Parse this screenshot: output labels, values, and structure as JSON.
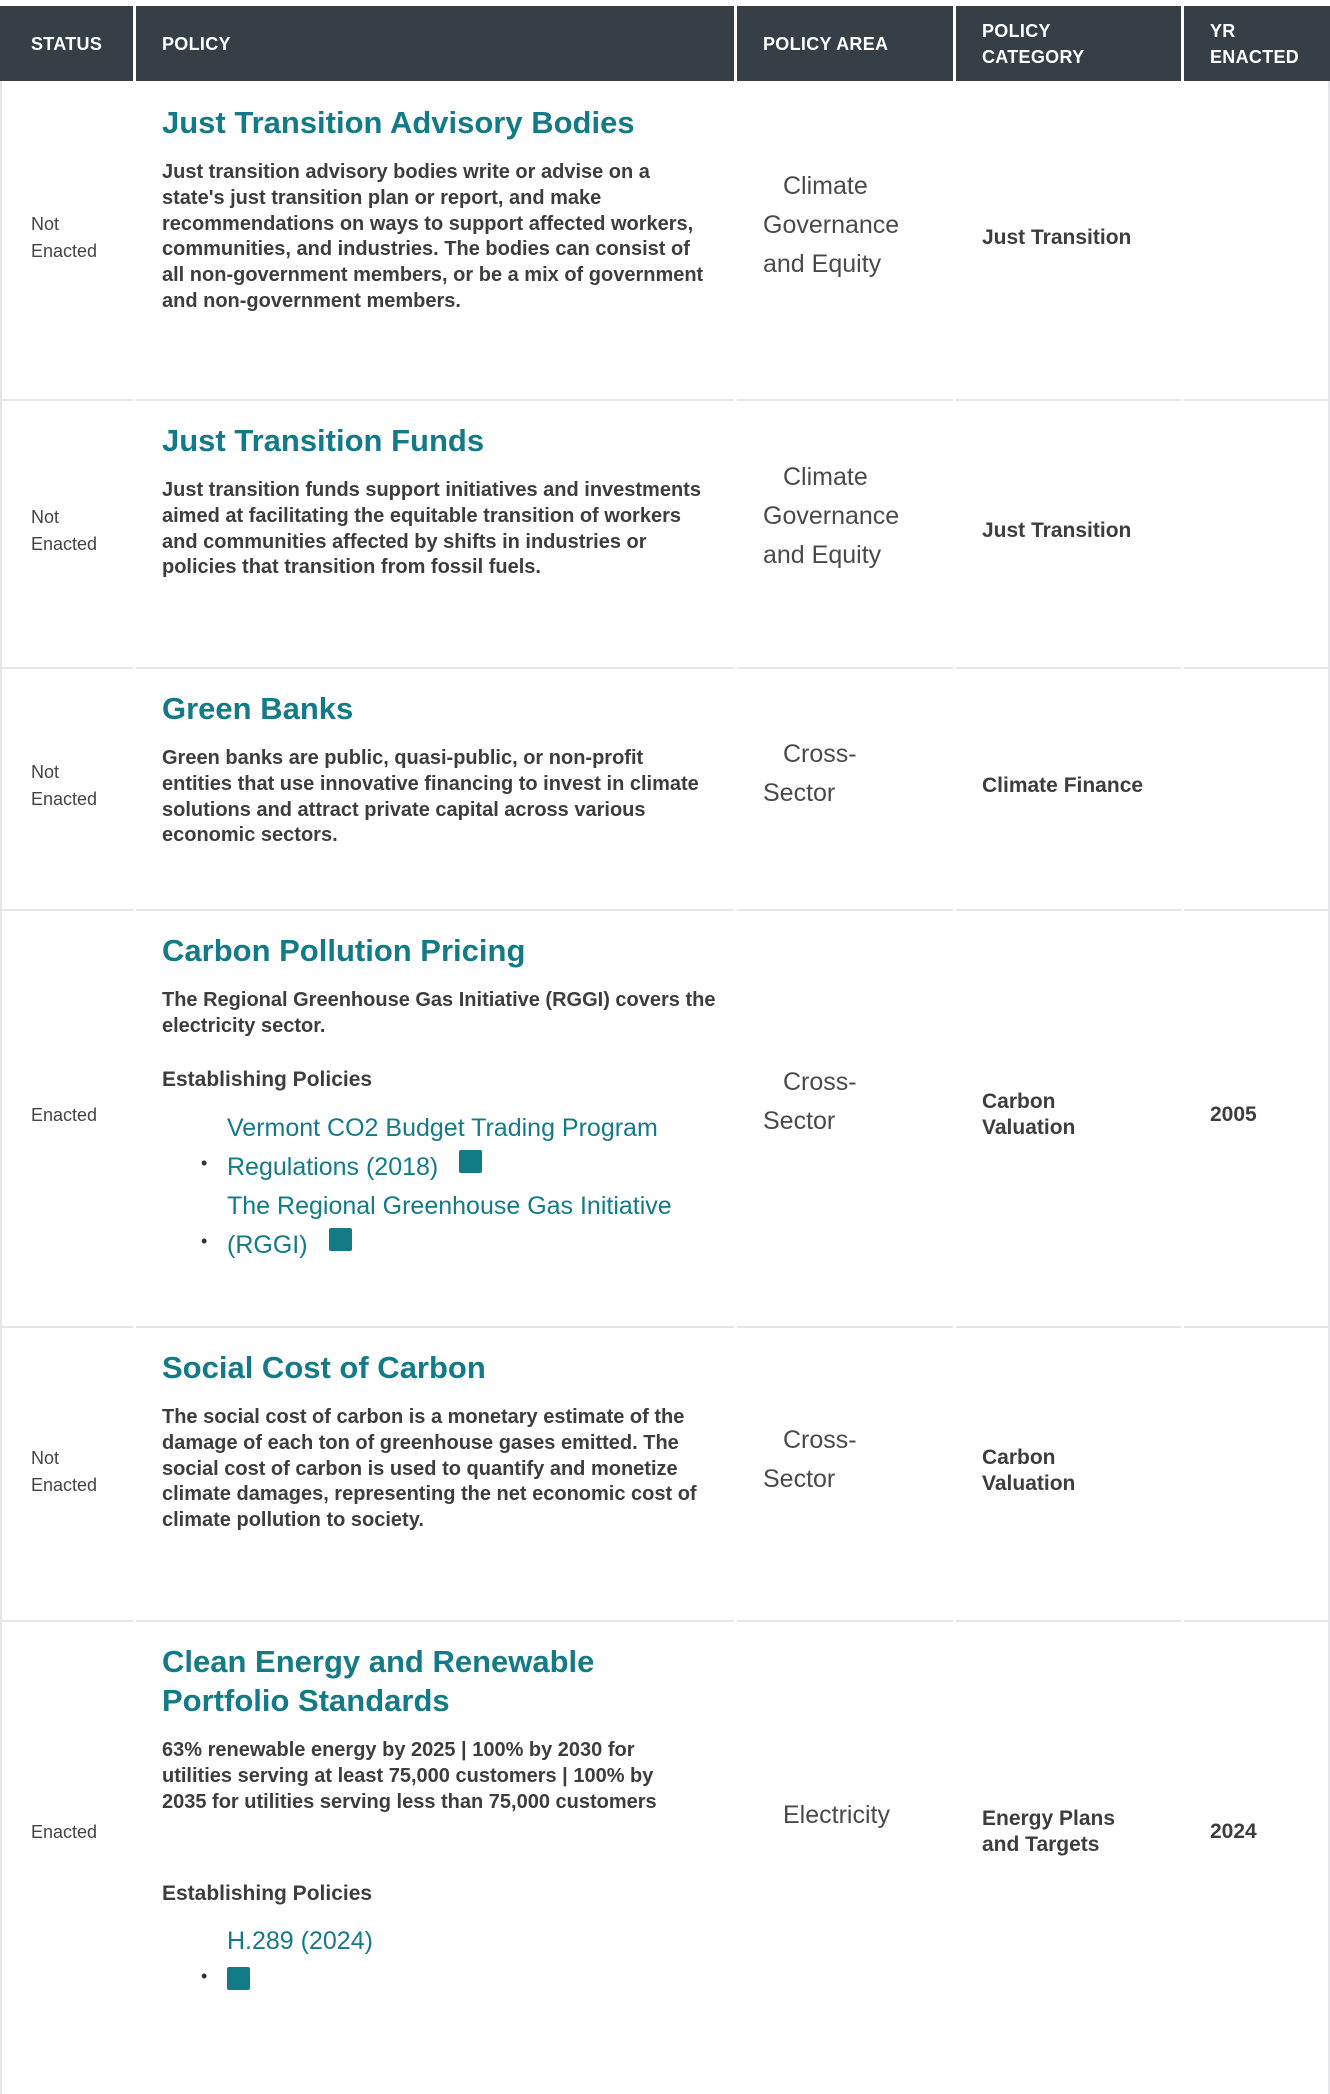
{
  "header": {
    "status": "STATUS",
    "policy": "POLICY",
    "policy_area": "POLICY AREA",
    "policy_category_1": "POLICY",
    "policy_category_2": "CATEGORY",
    "yr_enacted_1": "YR",
    "yr_enacted_2": "ENACTED"
  },
  "rows": [
    {
      "status_1": "Not",
      "status_2": "Enacted",
      "title": "Just Transition Advisory Bodies",
      "description": "Just transition advisory bodies write or advise on a state's just transition plan or report, and make recommendations on ways to support affected workers, communities, and industries. The bodies can consist of all non-government members, or be a mix of government and non-government members.",
      "area_1": "Climate",
      "area_2": "Governance",
      "area_3": "and Equity",
      "category_1": "Just Transition",
      "year": ""
    },
    {
      "status_1": "Not",
      "status_2": "Enacted",
      "title": "Just Transition Funds",
      "description": "Just transition funds support initiatives and investments aimed at facilitating the equitable transition of workers and communities affected by shifts in industries or policies that transition from fossil fuels.",
      "area_1": "Climate",
      "area_2": "Governance",
      "area_3": "and Equity",
      "category_1": "Just Transition",
      "year": ""
    },
    {
      "status_1": "Not",
      "status_2": "Enacted",
      "title": "Green Banks",
      "description": "Green banks are public, quasi-public, or non-profit entities that use innovative financing to invest in climate solutions and attract private capital across various economic sectors.",
      "area_1": "Cross-",
      "area_2": "Sector",
      "category_1": "Climate Finance",
      "year": ""
    },
    {
      "status_1": "Enacted",
      "title": "Carbon Pollution Pricing",
      "description": "The Regional Greenhouse Gas Initiative (RGGI) covers the electricity sector.",
      "establishing_label": "Establishing Policies",
      "links": [
        {
          "line_1": "Vermont CO2 Budget Trading Program",
          "line_2": "Regulations (2018)"
        },
        {
          "line_1": "The Regional Greenhouse Gas Initiative",
          "line_2": "(RGGI)"
        }
      ],
      "area_1": "Cross-",
      "area_2": "Sector",
      "category_1": "Carbon",
      "category_2": "Valuation",
      "year": "2005"
    },
    {
      "status_1": "Not",
      "status_2": "Enacted",
      "title": "Social Cost of Carbon",
      "description": "The social cost of carbon is a monetary estimate of the damage of each ton of greenhouse gases emitted. The social cost of carbon is used to quantify and monetize climate damages, representing the net economic cost of climate pollution to society.",
      "area_1": "Cross-",
      "area_2": "Sector",
      "category_1": "Carbon",
      "category_2": "Valuation",
      "year": ""
    },
    {
      "status_1": "Enacted",
      "title_1": "Clean Energy and Renewable",
      "title_2": "Portfolio Standards",
      "description": "63% renewable energy by 2025 | 100% by 2030 for utilities serving at least 75,000 customers | 100% by 2035 for utilities serving less than 75,000 customers",
      "establishing_label": "Establishing Policies",
      "links": [
        {
          "line_1": "H.289 (2024)"
        }
      ],
      "area_1": "Electricity",
      "category_1": "Energy Plans",
      "category_2": "and Targets",
      "year": "2024"
    }
  ],
  "icons": {
    "link_icon": "external-link-icon",
    "accent_color": "#137a87",
    "header_color": "#353f45"
  }
}
